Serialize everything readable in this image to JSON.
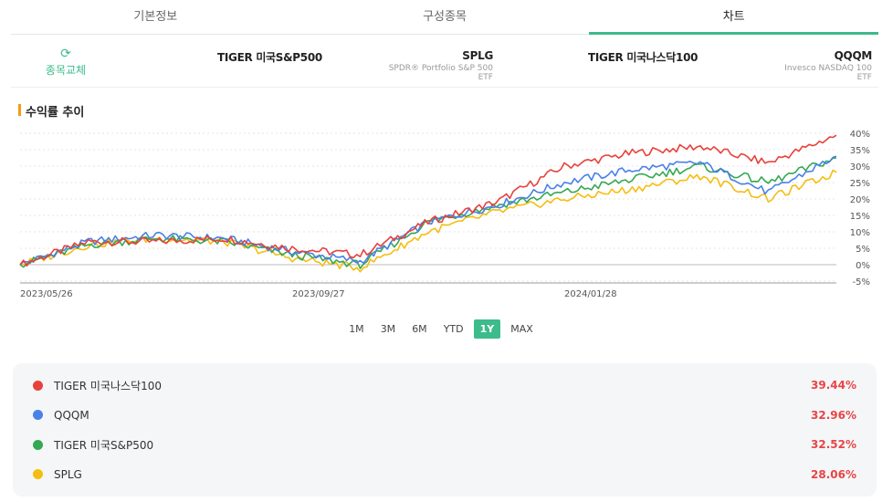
{
  "tabs": [
    {
      "label": "기본정보",
      "active": false
    },
    {
      "label": "구성종목",
      "active": false
    },
    {
      "label": "차트",
      "active": true
    }
  ],
  "swap": {
    "label": "종목교체",
    "icon": "refresh-icon"
  },
  "funds": [
    {
      "name": "TIGER 미국S&P500",
      "sub": ""
    },
    {
      "name": "SPLG",
      "sub": "SPDR® Portfolio S&P 500 ETF"
    },
    {
      "name": "TIGER 미국나스닥100",
      "sub": ""
    },
    {
      "name": "QQQM",
      "sub": "Invesco NASDAQ 100 ETF"
    }
  ],
  "section_title": "수익률 추이",
  "periods": [
    "1M",
    "3M",
    "6M",
    "YTD",
    "1Y",
    "MAX"
  ],
  "active_period": "1Y",
  "colors": {
    "red": "#e8413b",
    "blue": "#4a80e8",
    "green": "#34a853",
    "yellow": "#f5bd10",
    "accent": "#3cbb8b"
  },
  "chart_data": {
    "type": "line",
    "x_ticks": [
      "2023/05/26",
      "2023/09/27",
      "2024/01/28"
    ],
    "x": [
      "2023/05/26",
      "2023/06/26",
      "2023/07/26",
      "2023/08/26",
      "2023/09/26",
      "2023/10/26",
      "2023/11/26",
      "2023/12/26",
      "2024/01/26",
      "2024/02/26",
      "2024/03/26",
      "2024/04/26",
      "2024/05/26"
    ],
    "y_ticks": [
      "40%",
      "35%",
      "30%",
      "25%",
      "20%",
      "15%",
      "10%",
      "5%",
      "0%",
      "-5%"
    ],
    "ylim": [
      -5,
      40
    ],
    "series": [
      {
        "name": "TIGER 미국나스닥100",
        "color": "#e8413b",
        "return": "39.44%",
        "values": [
          0,
          7,
          7,
          8,
          5,
          3,
          13,
          19,
          30,
          34,
          36,
          31,
          39.4
        ]
      },
      {
        "name": "QQQM",
        "color": "#4a80e8",
        "return": "32.96%",
        "values": [
          0,
          7,
          9,
          8,
          4,
          1,
          13,
          18,
          25,
          29,
          31,
          22,
          33
        ]
      },
      {
        "name": "TIGER 미국S&P500",
        "color": "#34a853",
        "return": "32.52%",
        "values": [
          0,
          6,
          8,
          7,
          3,
          0,
          13,
          18,
          22,
          26,
          30,
          25,
          32.5
        ]
      },
      {
        "name": "SPLG",
        "color": "#f5bd10",
        "return": "28.06%",
        "values": [
          0,
          6,
          8,
          7,
          2,
          -1,
          10,
          16,
          20,
          23,
          27,
          20,
          28.1
        ]
      }
    ]
  }
}
